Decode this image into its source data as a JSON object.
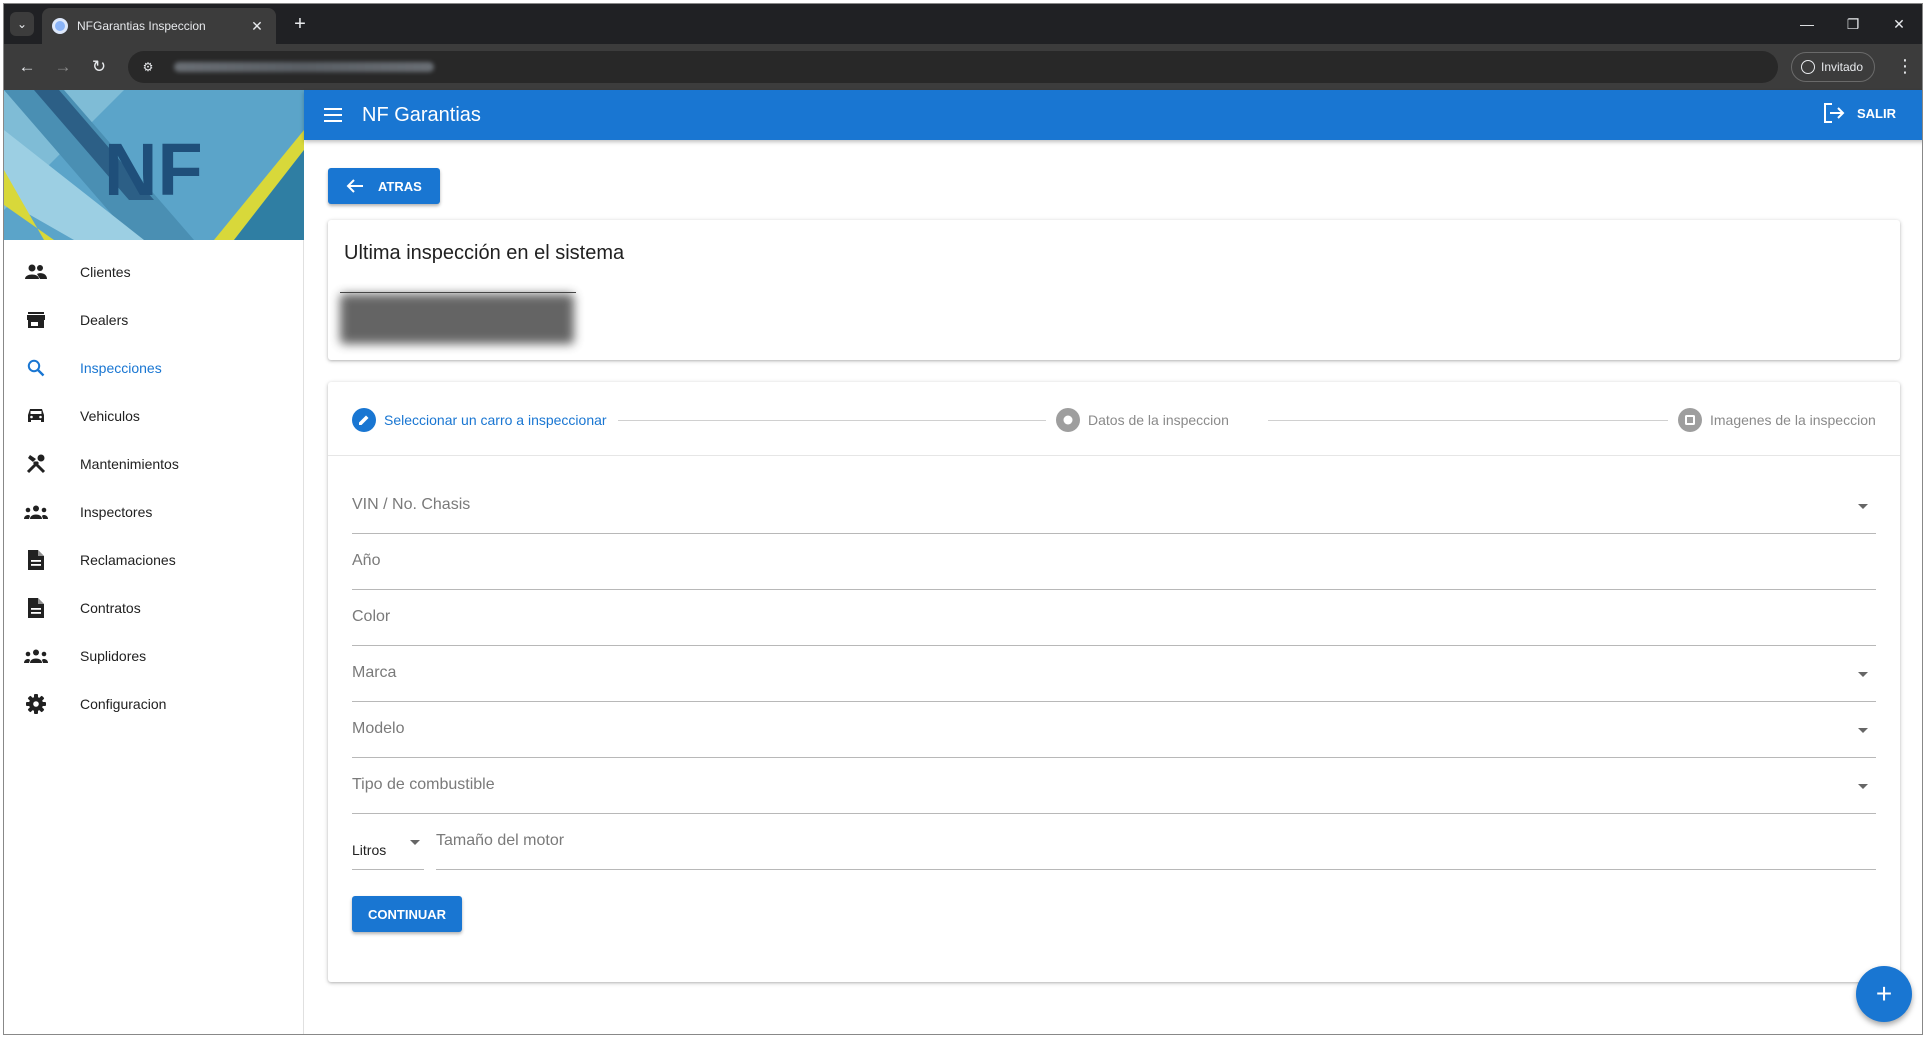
{
  "browser": {
    "tab_title": "NFGarantias Inspeccion",
    "tab_close": "✕",
    "new_tab": "+",
    "profile_label": "Invitado",
    "window_controls": [
      "—",
      "❐",
      "✕"
    ]
  },
  "app": {
    "title": "NF Garantias",
    "logout_label": "SALIR",
    "logo_text": "NF"
  },
  "sidebar": {
    "items": [
      {
        "label": "Clientes",
        "icon": "people-icon"
      },
      {
        "label": "Dealers",
        "icon": "store-icon"
      },
      {
        "label": "Inspecciones",
        "icon": "search-icon",
        "active": true
      },
      {
        "label": "Vehiculos",
        "icon": "car-icon"
      },
      {
        "label": "Mantenimientos",
        "icon": "tools-icon"
      },
      {
        "label": "Inspectores",
        "icon": "groups-icon"
      },
      {
        "label": "Reclamaciones",
        "icon": "document-icon"
      },
      {
        "label": "Contratos",
        "icon": "document-icon"
      },
      {
        "label": "Suplidores",
        "icon": "groups-icon"
      },
      {
        "label": "Configuracion",
        "icon": "gear-icon"
      }
    ]
  },
  "content": {
    "back_label": "ATRAS",
    "last_inspection_title": "Ultima inspección en el sistema",
    "steps": [
      {
        "label": "Seleccionar un carro a inspeccionar",
        "state": "active"
      },
      {
        "label": "Datos de la inspeccion",
        "state": "pending"
      },
      {
        "label": "Imagenes de la inspeccion",
        "state": "pending"
      }
    ],
    "fields": {
      "vin": "VIN / No. Chasis",
      "anio": "Año",
      "color": "Color",
      "marca": "Marca",
      "modelo": "Modelo",
      "combustible": "Tipo de combustible",
      "unit": "Litros",
      "motor": "Tamaño del motor"
    },
    "continue_label": "CONTINUAR",
    "fab_label": "+"
  },
  "colors": {
    "primary": "#1976d2",
    "browser_dark": "#202124"
  }
}
